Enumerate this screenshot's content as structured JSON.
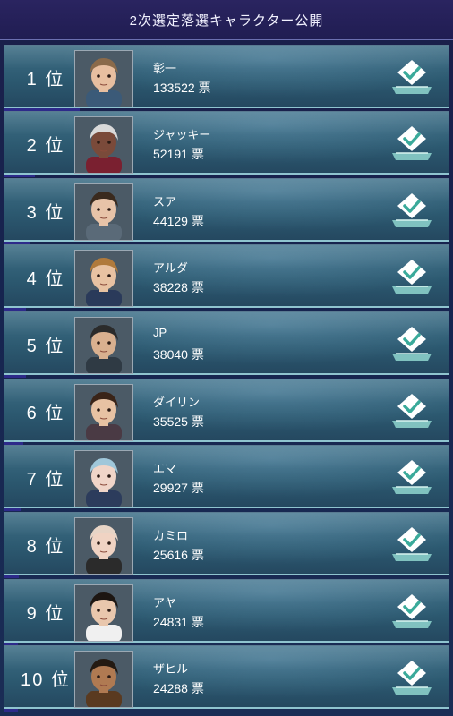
{
  "header": {
    "title": "2次選定落選キャラクター公開"
  },
  "icons": {
    "vote": "ballot-box-check-icon"
  },
  "colors": {
    "accent": "#2d2a8a",
    "check": "#3aaa9a"
  },
  "ranking": [
    {
      "rank": "1 位",
      "name": "彰一",
      "votes": "133522 票",
      "progress": 0.17
    },
    {
      "rank": "2 位",
      "name": "ジャッキー",
      "votes": "52191 票",
      "progress": 0.07
    },
    {
      "rank": "3 位",
      "name": "スア",
      "votes": "44129 票",
      "progress": 0.06
    },
    {
      "rank": "4 位",
      "name": "アルダ",
      "votes": "38228 票",
      "progress": 0.05
    },
    {
      "rank": "5 位",
      "name": "JP",
      "votes": "38040 票",
      "progress": 0.05
    },
    {
      "rank": "6 位",
      "name": "ダイリン",
      "votes": "35525 票",
      "progress": 0.045
    },
    {
      "rank": "7 位",
      "name": "エマ",
      "votes": "29927 票",
      "progress": 0.04
    },
    {
      "rank": "8 位",
      "name": "カミロ",
      "votes": "25616 票",
      "progress": 0.035
    },
    {
      "rank": "9 位",
      "name": "アヤ",
      "votes": "24831 票",
      "progress": 0.033
    },
    {
      "rank": "10 位",
      "name": "ザヒル",
      "votes": "24288 票",
      "progress": 0.032
    }
  ]
}
